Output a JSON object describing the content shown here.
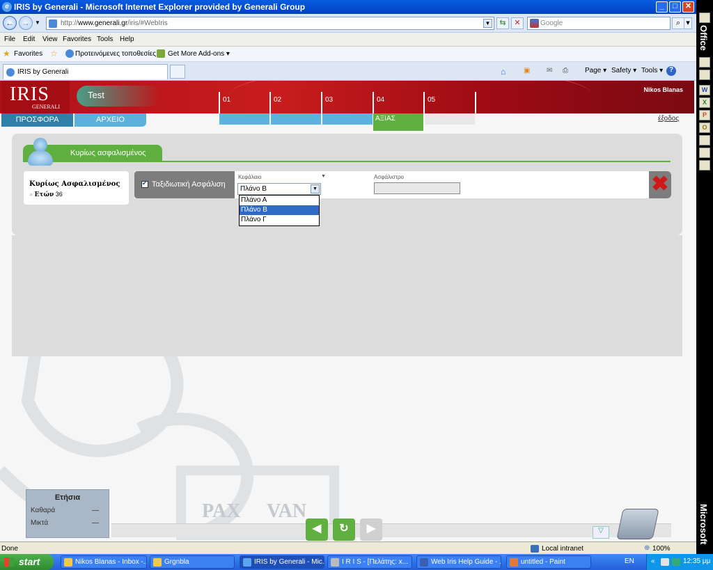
{
  "window": {
    "title": "IRIS by Generali - Microsoft Internet Explorer provided by Generali Group",
    "min": "_",
    "max": "□",
    "close": "✕"
  },
  "addressbar": {
    "url_prefix": "http://",
    "url_host": "www.generali.gr",
    "url_path": "/iris/#WebIris",
    "search_placeholder": "Google"
  },
  "menu": [
    "File",
    "Edit",
    "View",
    "Favorites",
    "Tools",
    "Help"
  ],
  "favorites": {
    "label": "Favorites",
    "suggested": "Προτεινόμενες τοποθεσίες ▾",
    "addons": "Get More Add-ons ▾"
  },
  "tab": {
    "label": "IRIS by Generali"
  },
  "commands": {
    "page": "Page ▾",
    "safety": "Safety ▾",
    "tools": "Tools ▾",
    "help": "?"
  },
  "officebar": {
    "office": "Office",
    "microsoft": "Microsoft"
  },
  "app": {
    "logo": "IRIS",
    "logo_sub": "GENERALI",
    "session": "Test",
    "user": "Nikos  Blanas",
    "steps": [
      "01",
      "02",
      "03",
      "04",
      "05"
    ],
    "nav": {
      "offer": "ΠΡΟΣΦΟΡΑ",
      "archive": "ΑΡΧΕΙΟ"
    },
    "step_active_label": "ΑΞΙΑΣ",
    "exit": "έξοδος",
    "section_title": "Κυρίως ασφαλισμένος",
    "insured": {
      "name": "Κυρίως Ασφαλισμένος",
      "arrow": "»",
      "age_label": "Ετών",
      "age": "36"
    },
    "cover": {
      "label": "Ταξιδιωτική Ασφάλιση",
      "capital_label": "Κεφάλαιο",
      "premium_label": "Ασφάλιστρο",
      "selected": "Πλάνο Β",
      "options": [
        "Πλάνο Α",
        "Πλάνο Β",
        "Πλάνο Γ"
      ]
    },
    "annual": {
      "title": "Ετήσια",
      "net_label": "Καθαρά",
      "net_value": "—",
      "gross_label": "Μικτά",
      "gross_value": "—"
    },
    "watermark": {
      "left": "PAX",
      "right": "VAN"
    }
  },
  "status": {
    "left": "Done",
    "zone": "Local intranet",
    "zoom": "100%"
  },
  "taskbar": {
    "start": "start",
    "tasks": [
      "Nikos Blanas - Inbox -...",
      "Grgnbla",
      "IRIS by Generali - Mic...",
      "I R I S - [Πελάτης: x...",
      "Web Iris Help Guide - ...",
      "untitled - Paint"
    ],
    "lang": "EN",
    "clock": "12:35 μμ"
  }
}
